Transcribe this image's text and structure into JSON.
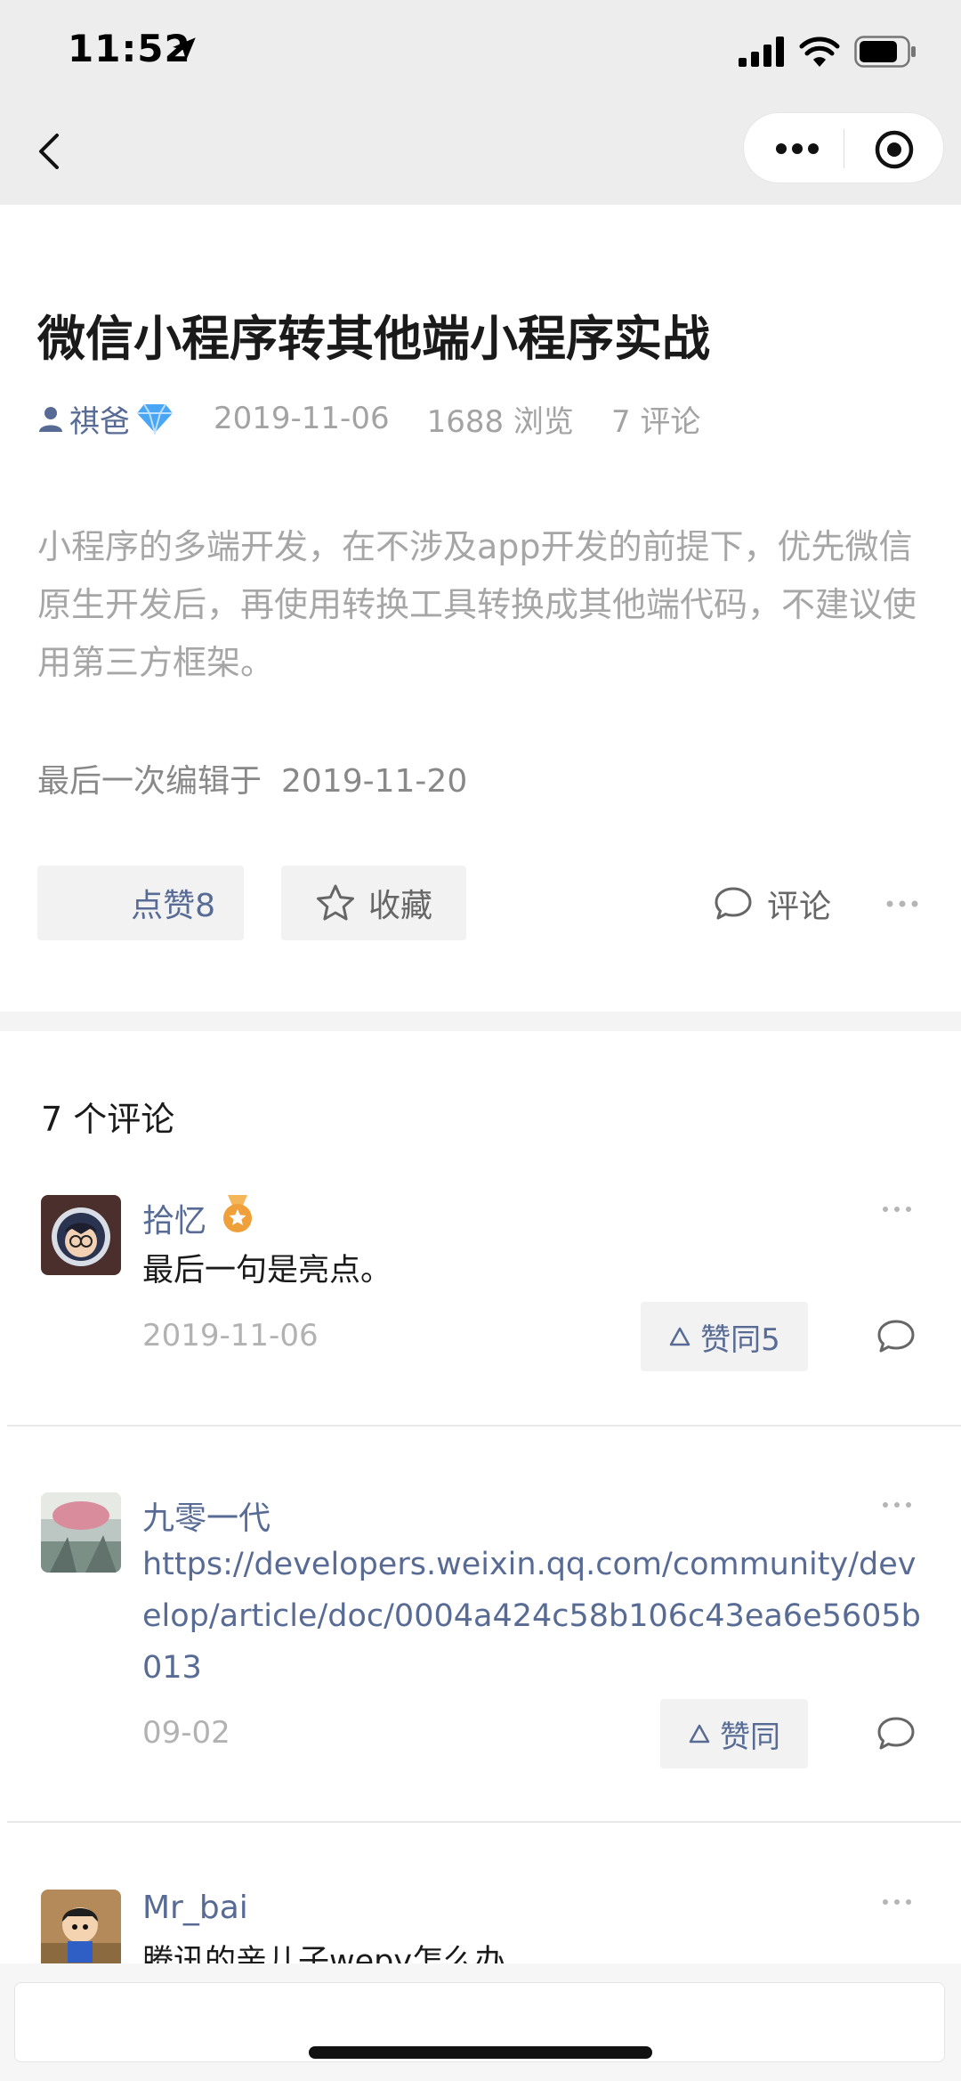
{
  "status_bar": {
    "time": "11:52"
  },
  "article": {
    "title": "微信小程序转其他端小程序实战",
    "author": "祺爸",
    "date": "2019-11-06",
    "views": "1688 浏览",
    "comments_count": "7 评论",
    "summary": "小程序的多端开发，在不涉及app开发的前提下，优先微信原生开发后，再使用转换工具转换成其他端代码，不建议使用第三方框架。",
    "edited_label": "最后一次编辑于",
    "edited_date": "2019-11-20",
    "like_label": "点赞8",
    "favorite_label": "收藏",
    "comment_label": "评论"
  },
  "comments_section": {
    "heading": "7 个评论",
    "items": [
      {
        "name": "拾忆",
        "text": "最后一句是亮点。",
        "date": "2019-11-06",
        "agree_label": "赞同5"
      },
      {
        "name": "九零一代",
        "text": "https://developers.weixin.qq.com/community/develop/article/doc/0004a424c58b106c43ea6e5605b013",
        "date": "09-02",
        "agree_label": "赞同"
      },
      {
        "name": "Mr_bai",
        "text": "腾讯的亲儿子wepy怎么办"
      }
    ]
  },
  "colors": {
    "link": "#576b95",
    "accent_gem": "#3aa0ff",
    "medal": "#f0a03a"
  },
  "icons": [
    "location-arrow-icon",
    "signal-icon",
    "wifi-icon",
    "battery-icon",
    "back-icon",
    "more-icon",
    "target-icon",
    "user-icon",
    "diamond-icon",
    "star-icon",
    "comment-icon",
    "medal-icon",
    "triangle-icon"
  ]
}
